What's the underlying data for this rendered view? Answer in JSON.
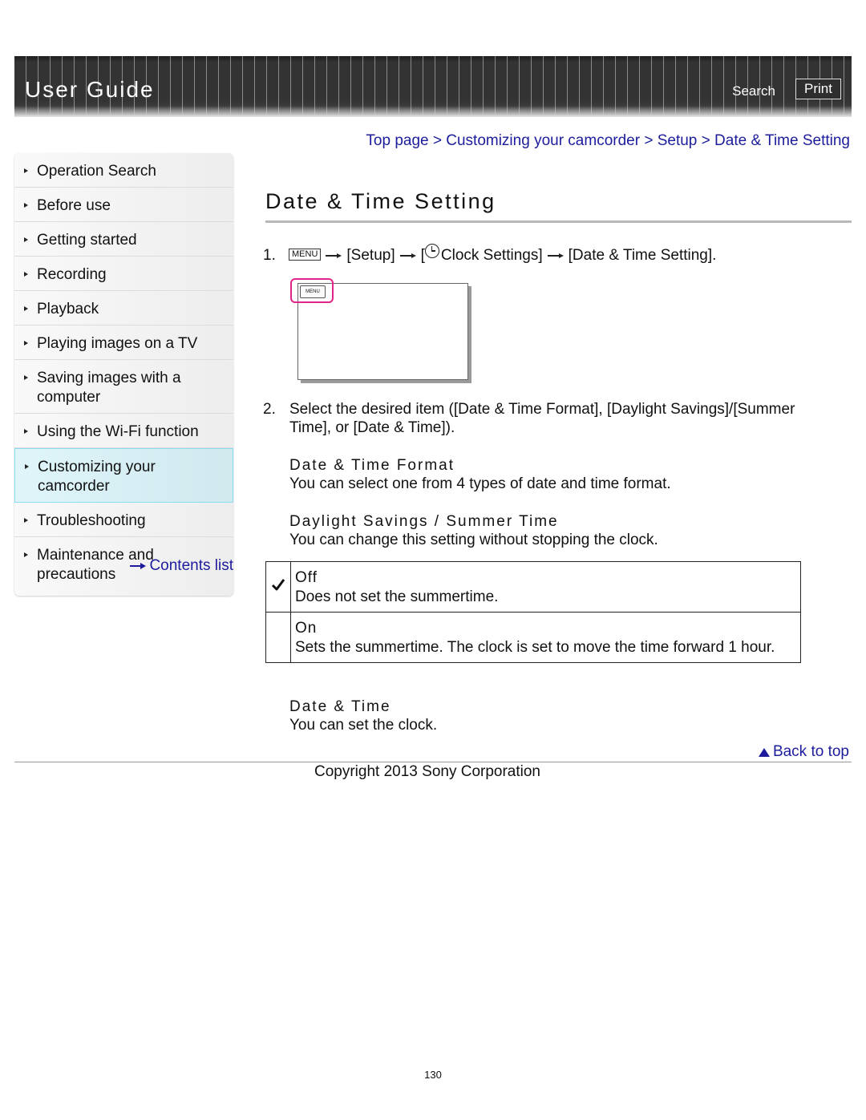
{
  "header": {
    "title": "User Guide",
    "search_label": "Search",
    "print_label": "Print"
  },
  "breadcrumb": {
    "items": [
      "Top page",
      "Customizing your camcorder",
      "Setup",
      "Date & Time Setting"
    ],
    "separator": ">"
  },
  "sidebar": {
    "items": [
      {
        "label": "Operation Search"
      },
      {
        "label": "Before use"
      },
      {
        "label": "Getting started"
      },
      {
        "label": "Recording"
      },
      {
        "label": "Playback"
      },
      {
        "label": "Playing images on a TV"
      },
      {
        "label": "Saving images with a computer"
      },
      {
        "label": "Using the Wi-Fi function"
      },
      {
        "label": "Customizing your camcorder",
        "active": true
      },
      {
        "label": "Troubleshooting"
      },
      {
        "label": "Maintenance and precautions"
      }
    ],
    "contents_link": "Contents list"
  },
  "main": {
    "title": "Date & Time Setting",
    "step1": {
      "num": "1.",
      "menu_key": "MENU",
      "setup": "[Setup]",
      "clock_open": "[",
      "clock": "Clock Settings]",
      "target": "[Date & Time Setting].",
      "illustration_button": "MENU"
    },
    "step2": {
      "num": "2.",
      "text": "Select the desired item ([Date & Time Format], [Daylight Savings]/[Summer Time], or [Date & Time])."
    },
    "items": [
      {
        "heading": "Date & Time Format",
        "text": "You can select one from 4 types of date and time format."
      },
      {
        "heading": "Daylight Savings / Summer Time",
        "text": "You can change this setting without stopping the clock."
      },
      {
        "heading": "Date & Time",
        "text": "You can set the clock."
      }
    ],
    "options": [
      {
        "checked": true,
        "name": "Off",
        "desc": "Does not set the summertime."
      },
      {
        "checked": false,
        "name": "On",
        "desc": "Sets the summertime. The clock is set to move the time forward 1 hour."
      }
    ]
  },
  "footer": {
    "back_to_top": "Back to top",
    "copyright": "Copyright 2013 Sony Corporation",
    "page_number": "130"
  },
  "colors": {
    "link": "#1c1c9c",
    "highlight": "#e0258a",
    "active_nav": "#dff5fa"
  }
}
